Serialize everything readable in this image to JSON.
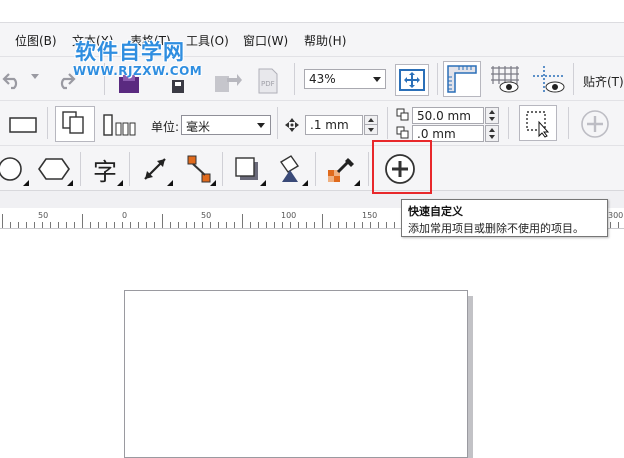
{
  "menubar": {
    "items": [
      {
        "label": "位图(B)"
      },
      {
        "label": "文本(X)"
      },
      {
        "label": "表格(T)"
      },
      {
        "label": "工具(O)"
      },
      {
        "label": "窗口(W)"
      },
      {
        "label": "帮助(H)"
      }
    ]
  },
  "watermark": {
    "title": "软件自学网",
    "url": "WWW.RJZXW.COM",
    "color": "#2f8ee0"
  },
  "toolbar_standard": {
    "zoom_value": "43%",
    "snap_label": "贴齐(T)",
    "icons": [
      "undo-icon",
      "redo-icon",
      "import-icon",
      "export-icon",
      "publish-pdf-icon",
      "full-screen-preview-icon",
      "show-rulers-icon",
      "show-grid-icon",
      "show-guidelines-icon"
    ]
  },
  "property_bar": {
    "units_label": "单位:",
    "units_value": "毫米",
    "nudge_value": ".1 mm",
    "dup_x_value": "50.0 mm",
    "dup_y_value": ".0 mm"
  },
  "toolbox": {
    "icons": [
      "ellipse-tool-icon",
      "polygon-tool-icon",
      "text-tool-icon",
      "dimension-tool-icon",
      "connector-tool-icon",
      "drop-shadow-tool-icon",
      "fill-tool-icon",
      "eyedropper-tool-icon",
      "quick-customize-icon"
    ],
    "text_tool_glyph": "字"
  },
  "ruler": {
    "labels": [
      "50",
      "0",
      "50",
      "100",
      "150",
      "300"
    ]
  },
  "tooltip": {
    "title": "快速自定义",
    "description": "添加常用项目或删除不使用的项目。"
  },
  "colors": {
    "highlight": "#e8282b",
    "toolbar_bg": "#f5f5f7",
    "accent_blue": "#2a6fb8"
  }
}
